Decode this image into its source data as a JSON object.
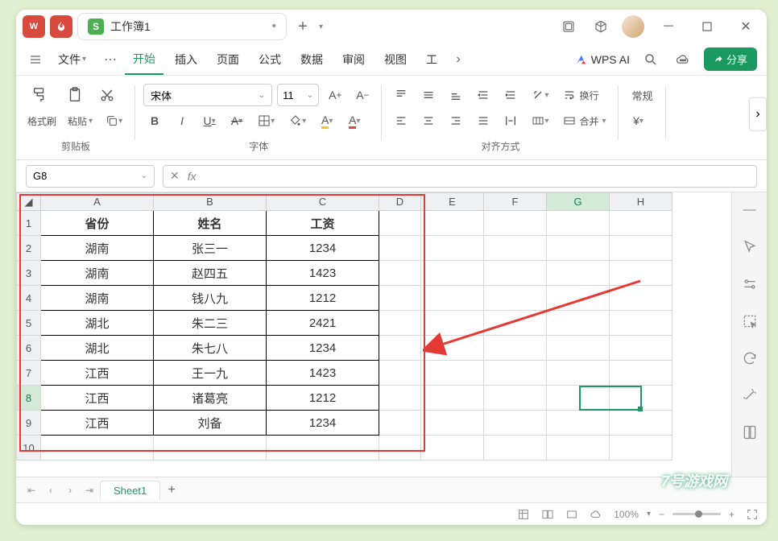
{
  "titlebar": {
    "app_badge": "W",
    "doc_icon": "S",
    "doc_title": "工作簿1",
    "plus": "+"
  },
  "menubar": {
    "file": "文件",
    "tabs": [
      "开始",
      "插入",
      "页面",
      "公式",
      "数据",
      "审阅",
      "视图",
      "工"
    ],
    "wps_ai": "WPS AI",
    "share": "分享"
  },
  "ribbon": {
    "clipboard": {
      "format_brush": "格式刷",
      "paste": "粘贴",
      "label": "剪贴板"
    },
    "font": {
      "name": "宋体",
      "size": "11",
      "label": "字体"
    },
    "align": {
      "wrap": "换行",
      "merge": "合并",
      "label": "对齐方式"
    },
    "number": {
      "general": "常规"
    }
  },
  "namebox": {
    "ref": "G8"
  },
  "columns": [
    "A",
    "B",
    "C",
    "D",
    "E",
    "F",
    "G",
    "H"
  ],
  "rows": [
    "1",
    "2",
    "3",
    "4",
    "5",
    "6",
    "7",
    "8",
    "9",
    "10"
  ],
  "data": {
    "headers": {
      "a": "省份",
      "b": "姓名",
      "c": "工资"
    },
    "r2": {
      "a": "湖南",
      "b": "张三一",
      "c": "1234"
    },
    "r3": {
      "a": "湖南",
      "b": "赵四五",
      "c": "1423"
    },
    "r4": {
      "a": "湖南",
      "b": "钱八九",
      "c": "1212"
    },
    "r5": {
      "a": "湖北",
      "b": "朱二三",
      "c": "2421"
    },
    "r6": {
      "a": "湖北",
      "b": "朱七八",
      "c": "1234"
    },
    "r7": {
      "a": "江西",
      "b": "王一九",
      "c": "1423"
    },
    "r8": {
      "a": "江西",
      "b": "诸葛亮",
      "c": "1212"
    },
    "r9": {
      "a": "江西",
      "b": "刘备",
      "c": "1234"
    }
  },
  "sheets": {
    "active": "Sheet1"
  },
  "status": {
    "zoom": "100%"
  },
  "watermark": "7号游戏网"
}
